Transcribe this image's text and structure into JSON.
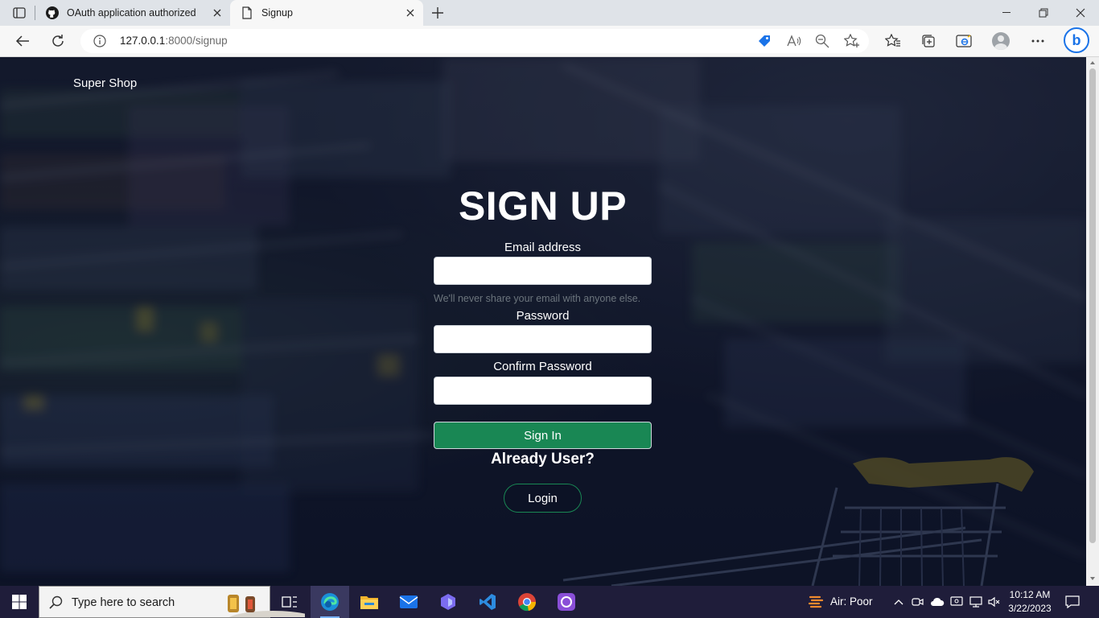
{
  "browser": {
    "tabs": [
      {
        "label": "OAuth application authorized",
        "icon": "github-icon"
      },
      {
        "label": "Signup",
        "icon": "page-icon",
        "active": true
      }
    ],
    "url_host": "127.0.0.1",
    "url_rest": ":8000/signup"
  },
  "page": {
    "brand": "Super Shop",
    "title": "SIGN UP",
    "email_label": "Email address",
    "email_value": "",
    "email_hint": "We'll never share your email with anyone else.",
    "password_label": "Password",
    "password_value": "",
    "confirm_label": "Confirm Password",
    "confirm_value": "",
    "signin_label": "Sign In",
    "already_text": "Already User?",
    "login_label": "Login"
  },
  "taskbar": {
    "search_placeholder": "Type here to search",
    "weather": "Air: Poor",
    "time": "10:12 AM",
    "date": "3/22/2023",
    "apps": [
      "task-view-icon",
      "edge-icon",
      "file-explorer-icon",
      "mail-icon",
      "app-icon",
      "vscode-icon",
      "chrome-icon",
      "github-desktop-icon"
    ]
  },
  "colors": {
    "accent_green": "#198754",
    "taskbar": "#1f1d3a",
    "page_bg": "#151c30"
  }
}
